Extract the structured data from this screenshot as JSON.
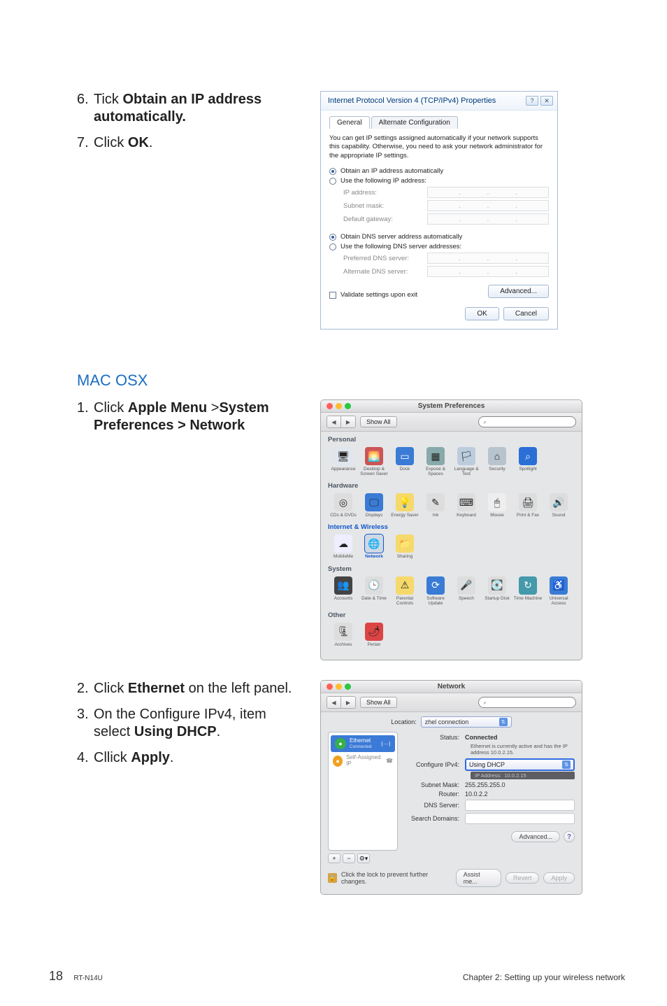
{
  "steps_a": [
    {
      "num": "6.",
      "pre": "Tick ",
      "bold": "Obtain an IP address automatically.",
      "post": ""
    },
    {
      "num": "7.",
      "pre": "Click ",
      "bold": "OK",
      "post": "."
    }
  ],
  "osx_heading": "MAC OSX",
  "steps_b1": [
    {
      "num": "1.",
      "pre": "Click ",
      "bold": "Apple Menu",
      "mid": " >",
      "bold2": "System Preferences > Network",
      "post": ""
    }
  ],
  "steps_b2": [
    {
      "num": "2.",
      "pre": "Click ",
      "bold": "Ethernet",
      "post": " on the left panel."
    },
    {
      "num": "3.",
      "pre": "On the Configure IPv4, item select ",
      "bold": "Using DHCP",
      "post": "."
    },
    {
      "num": "4.",
      "pre": "Cllick ",
      "bold": "Apply",
      "post": "."
    }
  ],
  "win": {
    "title": "Internet Protocol Version 4 (TCP/IPv4) Properties",
    "tab_general": "General",
    "tab_alt": "Alternate Configuration",
    "desc": "You can get IP settings assigned automatically if your network supports this capability. Otherwise, you need to ask your network administrator for the appropriate IP settings.",
    "r_obtain_ip": "Obtain an IP address automatically",
    "r_use_ip": "Use the following IP address:",
    "f_ip": "IP address:",
    "f_mask": "Subnet mask:",
    "f_gw": "Default gateway:",
    "r_obtain_dns": "Obtain DNS server address automatically",
    "r_use_dns": "Use the following DNS server addresses:",
    "f_pdns": "Preferred DNS server:",
    "f_adns": "Alternate DNS server:",
    "chk_validate": "Validate settings upon exit",
    "btn_adv": "Advanced...",
    "btn_ok": "OK",
    "btn_cancel": "Cancel"
  },
  "sysprefs": {
    "title": "System Preferences",
    "show_all": "Show All",
    "sections": {
      "personal": {
        "hdr": "Personal",
        "items": [
          "Appearance",
          "Desktop & Screen Saver",
          "Dock",
          "Exposé & Spaces",
          "Language & Text",
          "Security",
          "Spotlight"
        ]
      },
      "hardware": {
        "hdr": "Hardware",
        "items": [
          "CDs & DVDs",
          "Displays",
          "Energy Saver",
          "Ink",
          "Keyboard",
          "Mouse",
          "Print & Fax",
          "Sound"
        ]
      },
      "internet": {
        "hdr": "Internet & Wireless",
        "items": [
          "MobileMe",
          "Network",
          "Sharing"
        ]
      },
      "system": {
        "hdr": "System",
        "items": [
          "Accounts",
          "Date & Time",
          "Parental Controls",
          "Software Update",
          "Speech",
          "Startup Disk",
          "Time Machine",
          "Universal Access"
        ]
      },
      "other": {
        "hdr": "Other",
        "items": [
          "Archives",
          "Perian"
        ]
      }
    }
  },
  "netwin": {
    "title": "Network",
    "show_all": "Show All",
    "location_label": "Location:",
    "location_value": "zhel connection",
    "side": [
      {
        "name": "Ethernet",
        "sub": "Connected",
        "color": "#35b04a"
      },
      {
        "name": "Self-Assigned IP",
        "sub": "",
        "color": "#f0a020"
      }
    ],
    "status_k": "Status:",
    "status_v": "Connected",
    "status_sub": "Ethernet is currently active and has the IP address 10.0.2.15.",
    "cfg_k": "Configure IPv4:",
    "cfg_v": "Using DHCP",
    "ip_strip_k": "IP Address:",
    "ip_strip_v": "10.0.2.15",
    "mask_k": "Subnet Mask:",
    "mask_v": "255.255.255.0",
    "router_k": "Router:",
    "router_v": "10.0.2.2",
    "dns_k": "DNS Server:",
    "search_k": "Search Domains:",
    "btn_adv": "Advanced...",
    "lock_text": "Click the lock to prevent further changes.",
    "btn_assist": "Assist me...",
    "btn_revert": "Revert",
    "btn_apply": "Apply"
  },
  "footer": {
    "page": "18",
    "model": "RT-N14U",
    "chapter": "Chapter 2: Setting up your wireless network"
  }
}
